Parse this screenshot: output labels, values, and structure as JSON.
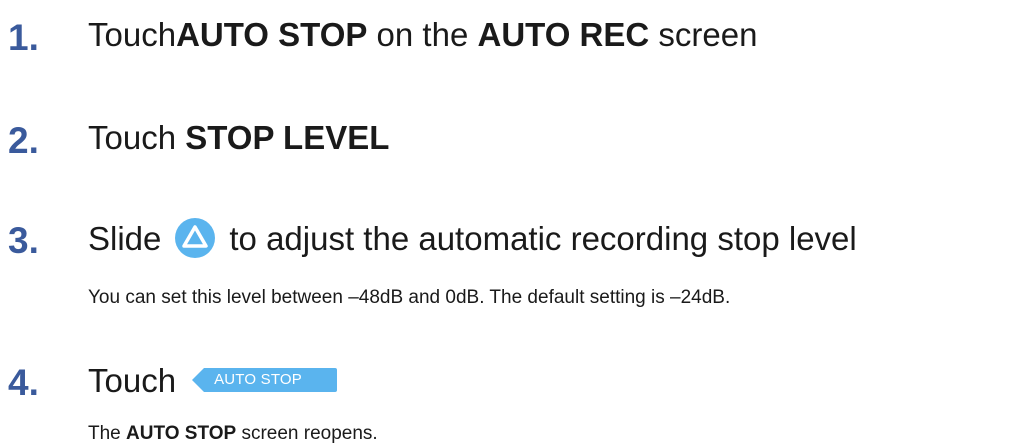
{
  "steps": [
    {
      "number": "1.",
      "parts": [
        "Touch ",
        "AUTO STOP",
        " on the ",
        "AUTO REC",
        " screen"
      ]
    },
    {
      "number": "2.",
      "parts": [
        "Touch ",
        "STOP LEVEL"
      ]
    },
    {
      "number": "3.",
      "before_icon": "Slide",
      "after_icon": "to adjust the automatic recording stop level",
      "icon": "slider-triangle-icon",
      "note": "You can set this level between –48dB and 0dB. The default setting is –24dB."
    },
    {
      "number": "4.",
      "before_button": "Touch",
      "button_label": "AUTO STOP",
      "note_parts": [
        "The ",
        "AUTO STOP",
        " screen reopens."
      ]
    }
  ],
  "colors": {
    "step_number": "#3a5a9c",
    "accent_blue": "#5ab4ee"
  }
}
